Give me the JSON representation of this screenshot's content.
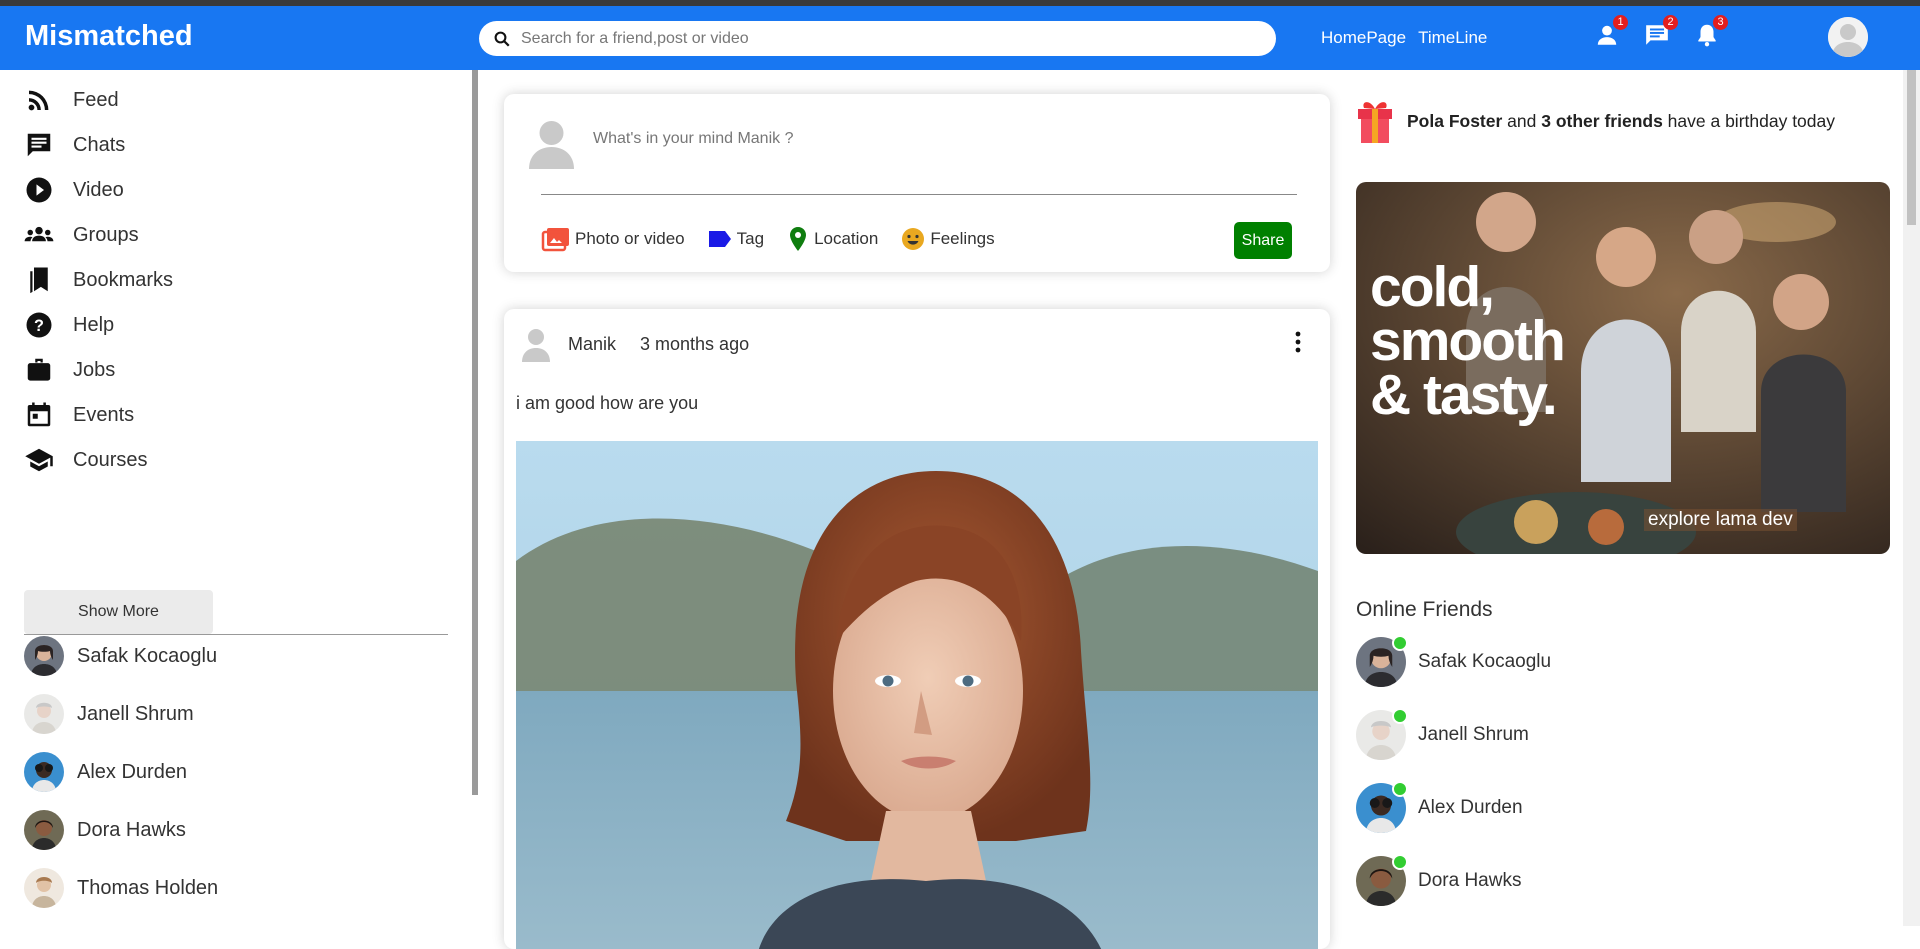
{
  "app": {
    "logo": "Mismatched"
  },
  "search": {
    "placeholder": "Search for a friend,post or video"
  },
  "nav": {
    "links": [
      "HomePage",
      "TimeLine"
    ]
  },
  "notifications": {
    "friends": "1",
    "messages": "2",
    "alerts": "3"
  },
  "sidebar": {
    "items": [
      {
        "label": "Feed",
        "icon": "rss-icon"
      },
      {
        "label": "Chats",
        "icon": "chat-icon"
      },
      {
        "label": "Video",
        "icon": "play-circle-icon"
      },
      {
        "label": "Groups",
        "icon": "groups-icon"
      },
      {
        "label": "Bookmarks",
        "icon": "bookmarks-icon"
      },
      {
        "label": "Help",
        "icon": "help-icon"
      },
      {
        "label": "Jobs",
        "icon": "briefcase-icon"
      },
      {
        "label": "Events",
        "icon": "calendar-icon"
      },
      {
        "label": "Courses",
        "icon": "graduation-cap-icon"
      }
    ],
    "show_more": "Show More",
    "friends": [
      "Safak Kocaoglu",
      "Janell Shrum",
      "Alex Durden",
      "Dora Hawks",
      "Thomas Holden"
    ]
  },
  "share": {
    "placeholder": "What's in your mind Manik ?",
    "options": [
      "Photo or video",
      "Tag",
      "Location",
      "Feelings"
    ],
    "button": "Share"
  },
  "post": {
    "author": "Manik",
    "time": "3 months ago",
    "text": "i am good how are you"
  },
  "rightbar": {
    "birthday": {
      "name": "Pola Foster",
      "mid": " and ",
      "others": "3 other friends",
      "tail": " have a birthday today"
    },
    "ad": {
      "headline1": "cold,",
      "headline2": "smooth",
      "headline3": "& tasty.",
      "cta": "explore lama dev"
    },
    "online_title": "Online Friends",
    "online": [
      "Safak Kocaoglu",
      "Janell Shrum",
      "Alex Durden",
      "Dora Hawks"
    ]
  },
  "colors": {
    "primary": "#1877f2",
    "share": "#008000",
    "online": "#32cd32",
    "badge": "#e41e1e"
  }
}
